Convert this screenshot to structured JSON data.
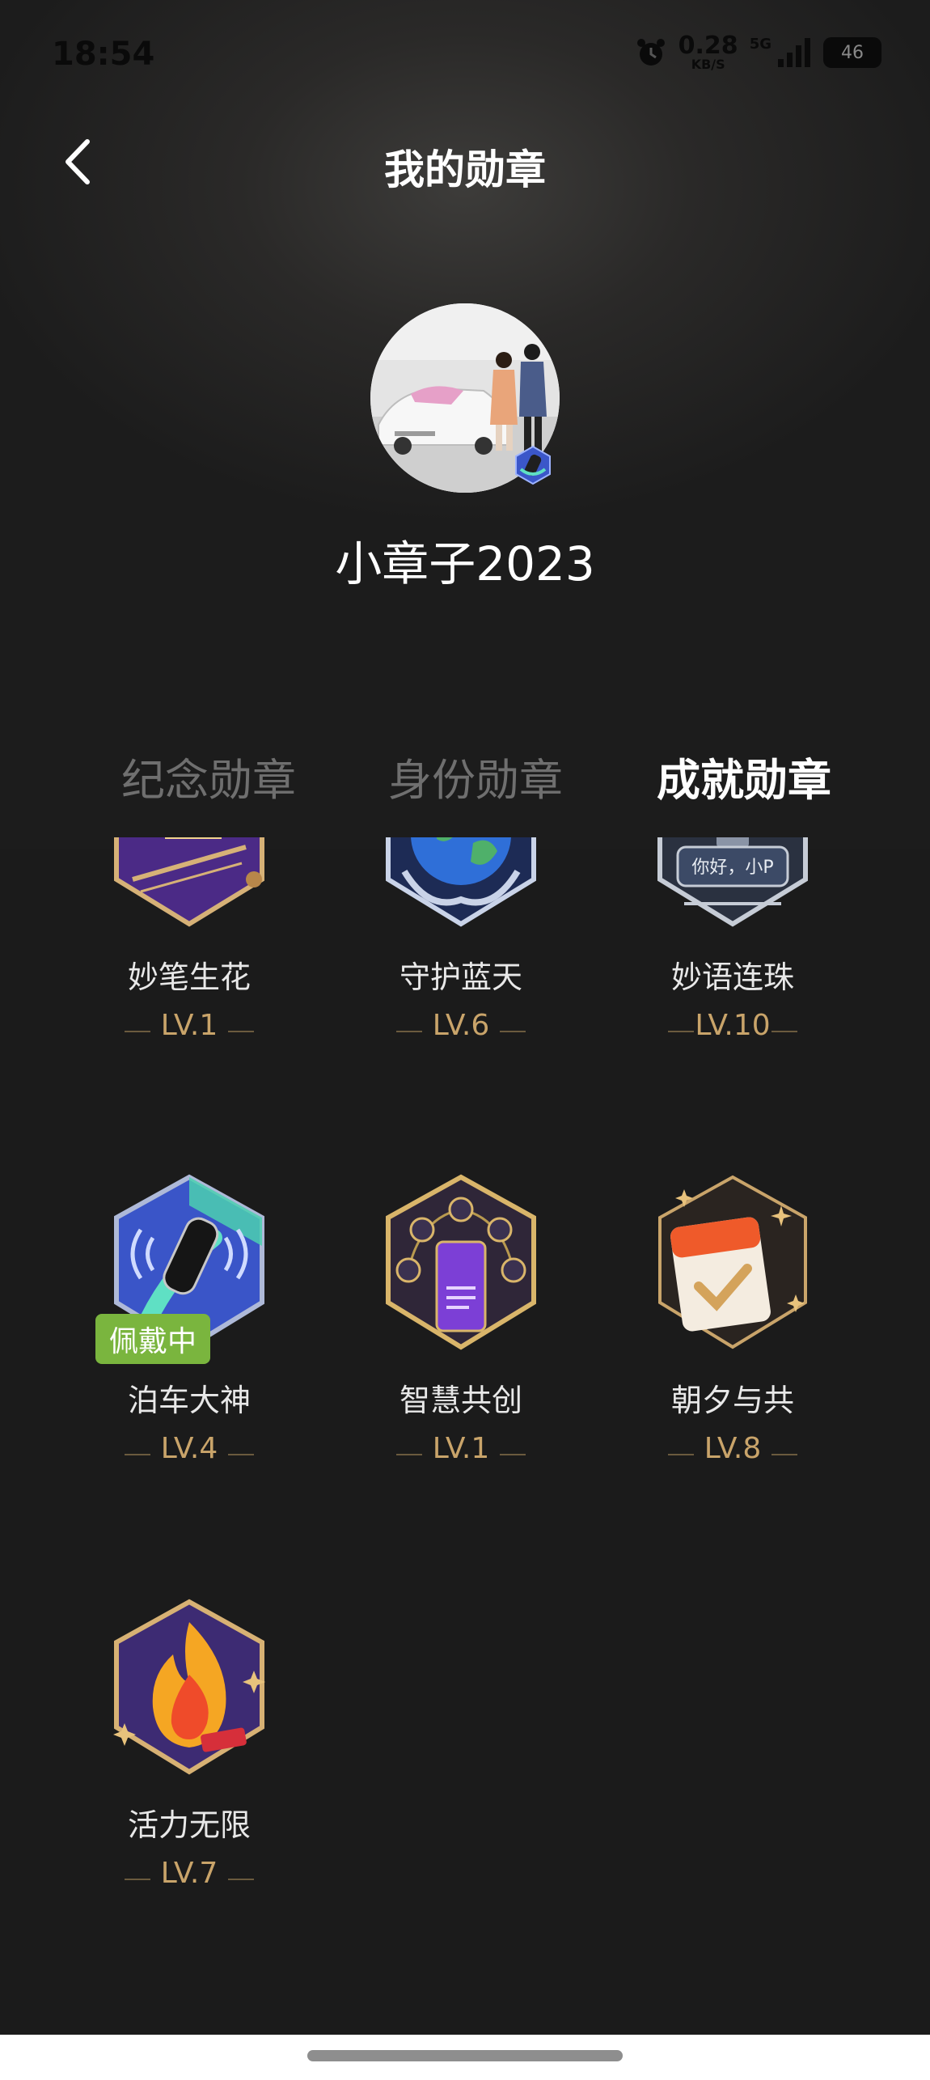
{
  "status_bar": {
    "time": "18:54",
    "speed_value": "0.28",
    "speed_unit": "KB/S",
    "network": "5G",
    "battery": "46"
  },
  "header": {
    "title": "我的勋章",
    "back_icon": "chevron-left-icon"
  },
  "profile": {
    "username": "小章子2023",
    "avatar_icon": "avatar-photo",
    "badge_icon": "parking-badge-icon"
  },
  "tabs": [
    {
      "label": "纪念勋章",
      "active": false
    },
    {
      "label": "身份勋章",
      "active": false
    },
    {
      "label": "成就勋章",
      "active": true
    }
  ],
  "medals": [
    {
      "name": "妙笔生花",
      "level": "LV.1",
      "icon": "pen-medal-icon"
    },
    {
      "name": "守护蓝天",
      "level": "LV.6",
      "icon": "earth-medal-icon"
    },
    {
      "name": "妙语连珠",
      "level": "LV.10",
      "icon": "voice-medal-icon",
      "icon_text": "你好，小P"
    },
    {
      "name": "泊车大神",
      "level": "LV.4",
      "icon": "parking-medal-icon",
      "tag": "佩戴中"
    },
    {
      "name": "智慧共创",
      "level": "LV.1",
      "icon": "smart-medal-icon"
    },
    {
      "name": "朝夕与共",
      "level": "LV.8",
      "icon": "calendar-medal-icon"
    },
    {
      "name": "活力无限",
      "level": "LV.7",
      "icon": "fire-medal-icon"
    }
  ],
  "colors": {
    "background": "#1b1b1b",
    "level_gold": "#c9a46a",
    "tag_green": "#7ab53e"
  }
}
